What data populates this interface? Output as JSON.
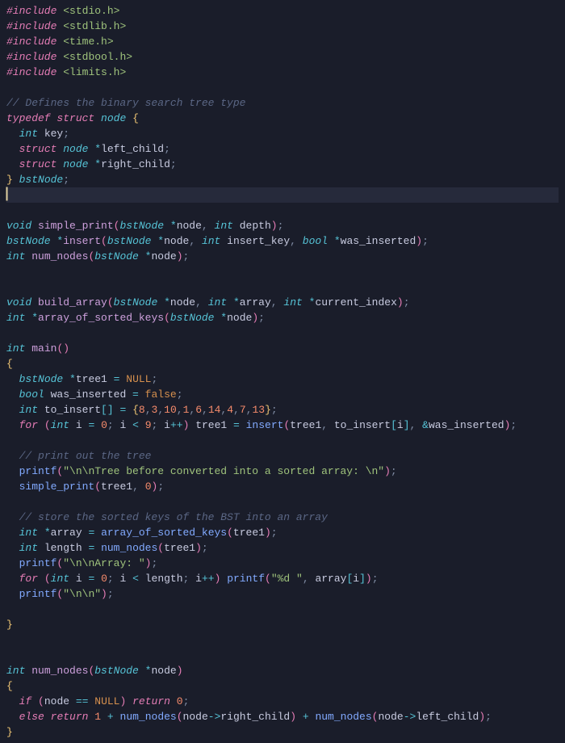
{
  "code": {
    "lines": [
      [
        [
          "pp",
          "#include"
        ],
        [
          "ident",
          " "
        ],
        [
          "inc",
          "<stdio.h>"
        ]
      ],
      [
        [
          "pp",
          "#include"
        ],
        [
          "ident",
          " "
        ],
        [
          "inc",
          "<stdlib.h>"
        ]
      ],
      [
        [
          "pp",
          "#include"
        ],
        [
          "ident",
          " "
        ],
        [
          "inc",
          "<time.h>"
        ]
      ],
      [
        [
          "pp",
          "#include"
        ],
        [
          "ident",
          " "
        ],
        [
          "inc",
          "<stdbool.h>"
        ]
      ],
      [
        [
          "pp",
          "#include"
        ],
        [
          "ident",
          " "
        ],
        [
          "inc",
          "<limits.h>"
        ]
      ],
      [],
      [
        [
          "cmt",
          "// Defines the binary search tree type"
        ]
      ],
      [
        [
          "kw",
          "typedef"
        ],
        [
          "ident",
          " "
        ],
        [
          "kw",
          "struct"
        ],
        [
          "ident",
          " "
        ],
        [
          "type",
          "node"
        ],
        [
          "ident",
          " "
        ],
        [
          "brace",
          "{"
        ]
      ],
      [
        [
          "ident",
          "  "
        ],
        [
          "type",
          "int"
        ],
        [
          "ident",
          " "
        ],
        [
          "field",
          "key"
        ],
        [
          "pun",
          ";"
        ]
      ],
      [
        [
          "ident",
          "  "
        ],
        [
          "kw",
          "struct"
        ],
        [
          "ident",
          " "
        ],
        [
          "type",
          "node"
        ],
        [
          "ident",
          " "
        ],
        [
          "op",
          "*"
        ],
        [
          "field",
          "left_child"
        ],
        [
          "pun",
          ";"
        ]
      ],
      [
        [
          "ident",
          "  "
        ],
        [
          "kw",
          "struct"
        ],
        [
          "ident",
          " "
        ],
        [
          "type",
          "node"
        ],
        [
          "ident",
          " "
        ],
        [
          "op",
          "*"
        ],
        [
          "field",
          "right_child"
        ],
        [
          "pun",
          ";"
        ]
      ],
      [
        [
          "brace",
          "}"
        ],
        [
          "ident",
          " "
        ],
        [
          "type",
          "bstNode"
        ],
        [
          "pun",
          ";"
        ]
      ],
      [],
      [],
      [
        [
          "type",
          "void"
        ],
        [
          "ident",
          " "
        ],
        [
          "fnd",
          "simple_print"
        ],
        [
          "paren",
          "("
        ],
        [
          "type",
          "bstNode"
        ],
        [
          "ident",
          " "
        ],
        [
          "op",
          "*"
        ],
        [
          "ident",
          "node"
        ],
        [
          "pun",
          ","
        ],
        [
          "ident",
          " "
        ],
        [
          "type",
          "int"
        ],
        [
          "ident",
          " depth"
        ],
        [
          "paren",
          ")"
        ],
        [
          "pun",
          ";"
        ]
      ],
      [
        [
          "type",
          "bstNode"
        ],
        [
          "ident",
          " "
        ],
        [
          "op",
          "*"
        ],
        [
          "fnd",
          "insert"
        ],
        [
          "paren",
          "("
        ],
        [
          "type",
          "bstNode"
        ],
        [
          "ident",
          " "
        ],
        [
          "op",
          "*"
        ],
        [
          "ident",
          "node"
        ],
        [
          "pun",
          ","
        ],
        [
          "ident",
          " "
        ],
        [
          "type",
          "int"
        ],
        [
          "ident",
          " insert_key"
        ],
        [
          "pun",
          ","
        ],
        [
          "ident",
          " "
        ],
        [
          "type",
          "bool"
        ],
        [
          "ident",
          " "
        ],
        [
          "op",
          "*"
        ],
        [
          "ident",
          "was_inserted"
        ],
        [
          "paren",
          ")"
        ],
        [
          "pun",
          ";"
        ]
      ],
      [
        [
          "type",
          "int"
        ],
        [
          "ident",
          " "
        ],
        [
          "fnd",
          "num_nodes"
        ],
        [
          "paren",
          "("
        ],
        [
          "type",
          "bstNode"
        ],
        [
          "ident",
          " "
        ],
        [
          "op",
          "*"
        ],
        [
          "ident",
          "node"
        ],
        [
          "paren",
          ")"
        ],
        [
          "pun",
          ";"
        ]
      ],
      [],
      [],
      [
        [
          "type",
          "void"
        ],
        [
          "ident",
          " "
        ],
        [
          "fnd",
          "build_array"
        ],
        [
          "paren",
          "("
        ],
        [
          "type",
          "bstNode"
        ],
        [
          "ident",
          " "
        ],
        [
          "op",
          "*"
        ],
        [
          "ident",
          "node"
        ],
        [
          "pun",
          ","
        ],
        [
          "ident",
          " "
        ],
        [
          "type",
          "int"
        ],
        [
          "ident",
          " "
        ],
        [
          "op",
          "*"
        ],
        [
          "ident",
          "array"
        ],
        [
          "pun",
          ","
        ],
        [
          "ident",
          " "
        ],
        [
          "type",
          "int"
        ],
        [
          "ident",
          " "
        ],
        [
          "op",
          "*"
        ],
        [
          "ident",
          "current_index"
        ],
        [
          "paren",
          ")"
        ],
        [
          "pun",
          ";"
        ]
      ],
      [
        [
          "type",
          "int"
        ],
        [
          "ident",
          " "
        ],
        [
          "op",
          "*"
        ],
        [
          "fnd",
          "array_of_sorted_keys"
        ],
        [
          "paren",
          "("
        ],
        [
          "type",
          "bstNode"
        ],
        [
          "ident",
          " "
        ],
        [
          "op",
          "*"
        ],
        [
          "ident",
          "node"
        ],
        [
          "paren",
          ")"
        ],
        [
          "pun",
          ";"
        ]
      ],
      [],
      [
        [
          "type",
          "int"
        ],
        [
          "ident",
          " "
        ],
        [
          "fnd",
          "main"
        ],
        [
          "paren",
          "()"
        ]
      ],
      [
        [
          "brace",
          "{"
        ]
      ],
      [
        [
          "ident",
          "  "
        ],
        [
          "type",
          "bstNode"
        ],
        [
          "ident",
          " "
        ],
        [
          "op",
          "*"
        ],
        [
          "ident",
          "tree1 "
        ],
        [
          "op",
          "="
        ],
        [
          "ident",
          " "
        ],
        [
          "const",
          "NULL"
        ],
        [
          "pun",
          ";"
        ]
      ],
      [
        [
          "ident",
          "  "
        ],
        [
          "type",
          "bool"
        ],
        [
          "ident",
          " was_inserted "
        ],
        [
          "op",
          "="
        ],
        [
          "ident",
          " "
        ],
        [
          "const",
          "false"
        ],
        [
          "pun",
          ";"
        ]
      ],
      [
        [
          "ident",
          "  "
        ],
        [
          "type",
          "int"
        ],
        [
          "ident",
          " to_insert"
        ],
        [
          "op",
          "[]"
        ],
        [
          "ident",
          " "
        ],
        [
          "op",
          "="
        ],
        [
          "ident",
          " "
        ],
        [
          "brace",
          "{"
        ],
        [
          "num",
          "8"
        ],
        [
          "pun",
          ","
        ],
        [
          "num",
          "3"
        ],
        [
          "pun",
          ","
        ],
        [
          "num",
          "10"
        ],
        [
          "pun",
          ","
        ],
        [
          "num",
          "1"
        ],
        [
          "pun",
          ","
        ],
        [
          "num",
          "6"
        ],
        [
          "pun",
          ","
        ],
        [
          "num",
          "14"
        ],
        [
          "pun",
          ","
        ],
        [
          "num",
          "4"
        ],
        [
          "pun",
          ","
        ],
        [
          "num",
          "7"
        ],
        [
          "pun",
          ","
        ],
        [
          "num",
          "13"
        ],
        [
          "brace",
          "}"
        ],
        [
          "pun",
          ";"
        ]
      ],
      [
        [
          "ident",
          "  "
        ],
        [
          "kw",
          "for"
        ],
        [
          "ident",
          " "
        ],
        [
          "paren",
          "("
        ],
        [
          "type",
          "int"
        ],
        [
          "ident",
          " i "
        ],
        [
          "op",
          "="
        ],
        [
          "ident",
          " "
        ],
        [
          "num",
          "0"
        ],
        [
          "pun",
          ";"
        ],
        [
          "ident",
          " i "
        ],
        [
          "op",
          "<"
        ],
        [
          "ident",
          " "
        ],
        [
          "num",
          "9"
        ],
        [
          "pun",
          ";"
        ],
        [
          "ident",
          " i"
        ],
        [
          "op",
          "++"
        ],
        [
          "paren",
          ")"
        ],
        [
          "ident",
          " tree1 "
        ],
        [
          "op",
          "="
        ],
        [
          "ident",
          " "
        ],
        [
          "fn",
          "insert"
        ],
        [
          "paren",
          "("
        ],
        [
          "ident",
          "tree1"
        ],
        [
          "pun",
          ","
        ],
        [
          "ident",
          " to_insert"
        ],
        [
          "op",
          "["
        ],
        [
          "ident",
          "i"
        ],
        [
          "op",
          "]"
        ],
        [
          "pun",
          ","
        ],
        [
          "ident",
          " "
        ],
        [
          "op",
          "&"
        ],
        [
          "ident",
          "was_inserted"
        ],
        [
          "paren",
          ")"
        ],
        [
          "pun",
          ";"
        ]
      ],
      [],
      [
        [
          "ident",
          "  "
        ],
        [
          "cmt",
          "// print out the tree"
        ]
      ],
      [
        [
          "ident",
          "  "
        ],
        [
          "fn",
          "printf"
        ],
        [
          "paren",
          "("
        ],
        [
          "str",
          "\"\\n\\nTree before converted into a sorted array: \\n\""
        ],
        [
          "paren",
          ")"
        ],
        [
          "pun",
          ";"
        ]
      ],
      [
        [
          "ident",
          "  "
        ],
        [
          "fn",
          "simple_print"
        ],
        [
          "paren",
          "("
        ],
        [
          "ident",
          "tree1"
        ],
        [
          "pun",
          ","
        ],
        [
          "ident",
          " "
        ],
        [
          "num",
          "0"
        ],
        [
          "paren",
          ")"
        ],
        [
          "pun",
          ";"
        ]
      ],
      [],
      [
        [
          "ident",
          "  "
        ],
        [
          "cmt",
          "// store the sorted keys of the BST into an array"
        ]
      ],
      [
        [
          "ident",
          "  "
        ],
        [
          "type",
          "int"
        ],
        [
          "ident",
          " "
        ],
        [
          "op",
          "*"
        ],
        [
          "ident",
          "array "
        ],
        [
          "op",
          "="
        ],
        [
          "ident",
          " "
        ],
        [
          "fn",
          "array_of_sorted_keys"
        ],
        [
          "paren",
          "("
        ],
        [
          "ident",
          "tree1"
        ],
        [
          "paren",
          ")"
        ],
        [
          "pun",
          ";"
        ]
      ],
      [
        [
          "ident",
          "  "
        ],
        [
          "type",
          "int"
        ],
        [
          "ident",
          " length "
        ],
        [
          "op",
          "="
        ],
        [
          "ident",
          " "
        ],
        [
          "fn",
          "num_nodes"
        ],
        [
          "paren",
          "("
        ],
        [
          "ident",
          "tree1"
        ],
        [
          "paren",
          ")"
        ],
        [
          "pun",
          ";"
        ]
      ],
      [
        [
          "ident",
          "  "
        ],
        [
          "fn",
          "printf"
        ],
        [
          "paren",
          "("
        ],
        [
          "str",
          "\"\\n\\nArray: \""
        ],
        [
          "paren",
          ")"
        ],
        [
          "pun",
          ";"
        ]
      ],
      [
        [
          "ident",
          "  "
        ],
        [
          "kw",
          "for"
        ],
        [
          "ident",
          " "
        ],
        [
          "paren",
          "("
        ],
        [
          "type",
          "int"
        ],
        [
          "ident",
          " i "
        ],
        [
          "op",
          "="
        ],
        [
          "ident",
          " "
        ],
        [
          "num",
          "0"
        ],
        [
          "pun",
          ";"
        ],
        [
          "ident",
          " i "
        ],
        [
          "op",
          "<"
        ],
        [
          "ident",
          " length"
        ],
        [
          "pun",
          ";"
        ],
        [
          "ident",
          " i"
        ],
        [
          "op",
          "++"
        ],
        [
          "paren",
          ")"
        ],
        [
          "ident",
          " "
        ],
        [
          "fn",
          "printf"
        ],
        [
          "paren",
          "("
        ],
        [
          "str",
          "\"%d \""
        ],
        [
          "pun",
          ","
        ],
        [
          "ident",
          " array"
        ],
        [
          "op",
          "["
        ],
        [
          "ident",
          "i"
        ],
        [
          "op",
          "]"
        ],
        [
          "paren",
          ")"
        ],
        [
          "pun",
          ";"
        ]
      ],
      [
        [
          "ident",
          "  "
        ],
        [
          "fn",
          "printf"
        ],
        [
          "paren",
          "("
        ],
        [
          "str",
          "\"\\n\\n\""
        ],
        [
          "paren",
          ")"
        ],
        [
          "pun",
          ";"
        ]
      ],
      [],
      [
        [
          "brace",
          "}"
        ]
      ],
      [],
      [],
      [
        [
          "type",
          "int"
        ],
        [
          "ident",
          " "
        ],
        [
          "fnd",
          "num_nodes"
        ],
        [
          "paren",
          "("
        ],
        [
          "type",
          "bstNode"
        ],
        [
          "ident",
          " "
        ],
        [
          "op",
          "*"
        ],
        [
          "ident",
          "node"
        ],
        [
          "paren",
          ")"
        ]
      ],
      [
        [
          "brace",
          "{"
        ]
      ],
      [
        [
          "ident",
          "  "
        ],
        [
          "kw",
          "if"
        ],
        [
          "ident",
          " "
        ],
        [
          "paren",
          "("
        ],
        [
          "ident",
          "node "
        ],
        [
          "op",
          "=="
        ],
        [
          "ident",
          " "
        ],
        [
          "const",
          "NULL"
        ],
        [
          "paren",
          ")"
        ],
        [
          "ident",
          " "
        ],
        [
          "kw",
          "return"
        ],
        [
          "ident",
          " "
        ],
        [
          "num",
          "0"
        ],
        [
          "pun",
          ";"
        ]
      ],
      [
        [
          "ident",
          "  "
        ],
        [
          "kw",
          "else"
        ],
        [
          "ident",
          " "
        ],
        [
          "kw",
          "return"
        ],
        [
          "ident",
          " "
        ],
        [
          "num",
          "1"
        ],
        [
          "ident",
          " "
        ],
        [
          "op",
          "+"
        ],
        [
          "ident",
          " "
        ],
        [
          "fn",
          "num_nodes"
        ],
        [
          "paren",
          "("
        ],
        [
          "ident",
          "node"
        ],
        [
          "op",
          "->"
        ],
        [
          "field",
          "right_child"
        ],
        [
          "paren",
          ")"
        ],
        [
          "ident",
          " "
        ],
        [
          "op",
          "+"
        ],
        [
          "ident",
          " "
        ],
        [
          "fn",
          "num_nodes"
        ],
        [
          "paren",
          "("
        ],
        [
          "ident",
          "node"
        ],
        [
          "op",
          "->"
        ],
        [
          "field",
          "left_child"
        ],
        [
          "paren",
          ")"
        ],
        [
          "pun",
          ";"
        ]
      ],
      [
        [
          "brace",
          "}"
        ]
      ]
    ],
    "cursor_line": 12
  }
}
